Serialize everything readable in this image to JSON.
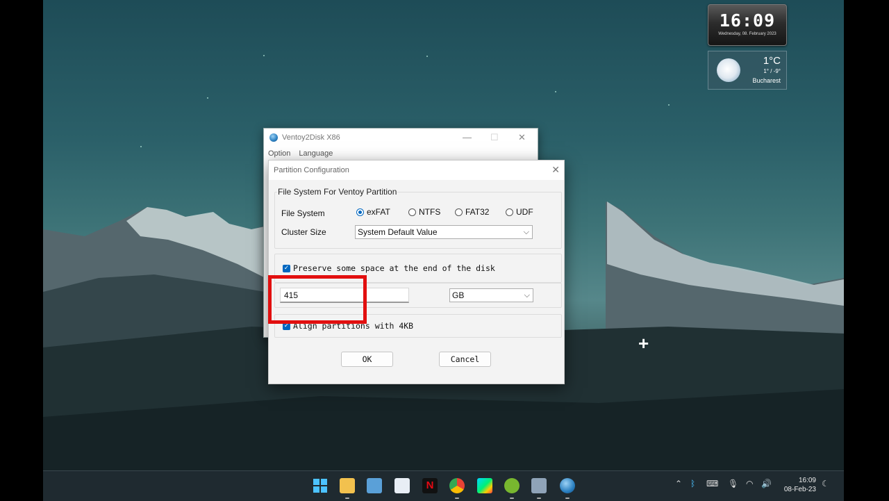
{
  "widgets": {
    "clock": {
      "time": "16:09",
      "date": "Wednesday, 08. February 2023"
    },
    "weather": {
      "temperature": "1°C",
      "range": "1° / -9°",
      "city": "Bucharest"
    }
  },
  "back_window": {
    "title": "Ventoy2Disk  X86",
    "menu": [
      "Option",
      "Language"
    ]
  },
  "dialog": {
    "title": "Partition Configuration",
    "fs_group_title": "File System For Ventoy Partition",
    "file_system_label": "File System",
    "file_system_options": [
      "exFAT",
      "NTFS",
      "FAT32",
      "UDF"
    ],
    "file_system_selected": "exFAT",
    "cluster_size_label": "Cluster Size",
    "cluster_size_value": "System Default Value",
    "preserve_label": "Preserve some space at the end of the disk",
    "preserve_checked": true,
    "preserve_value": "415",
    "preserve_unit": "GB",
    "align_label": "Align partitions with 4KB",
    "align_checked": true,
    "ok_label": "OK",
    "cancel_label": "Cancel"
  },
  "taskbar": {
    "time": "16:09",
    "date": "08-Feb-23",
    "apps": [
      "start-icon",
      "file-explorer-icon",
      "photos-icon",
      "store-icon",
      "netflix-icon",
      "chrome-icon",
      "play-store-icon",
      "utorrent-icon",
      "printer-app-icon",
      "ventoy-icon"
    ]
  },
  "colors": {
    "accent": "#0067c0",
    "highlight": "#e20f0f"
  }
}
